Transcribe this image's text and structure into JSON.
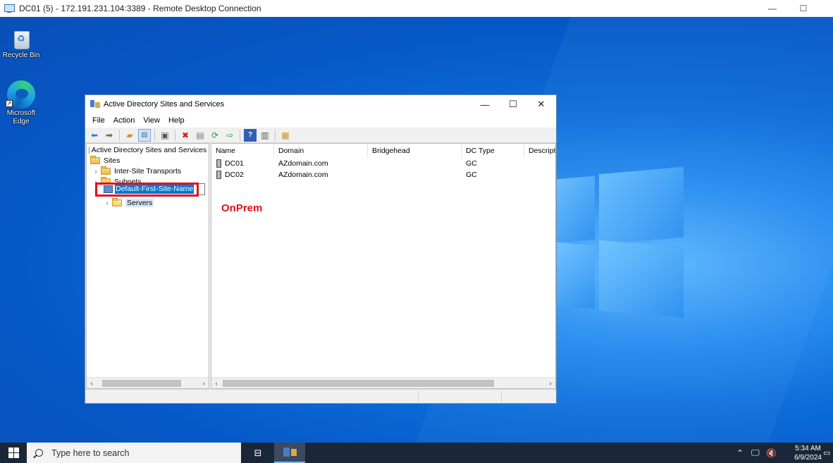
{
  "rdp": {
    "title": "DC01 (5) - 172.191.231.104:3389 - Remote Desktop Connection",
    "minimize": "—",
    "maximize": "☐"
  },
  "desktop": {
    "icons": [
      {
        "label": "Recycle Bin",
        "icon": "recycle-bin-icon"
      },
      {
        "label": "Microsoft Edge",
        "icon": "edge-icon"
      }
    ]
  },
  "window": {
    "title": "Active Directory Sites and Services",
    "minimize": "—",
    "maximize": "☐",
    "close": "✕",
    "menu": [
      "File",
      "Action",
      "View",
      "Help"
    ]
  },
  "tree": {
    "root": "Active Directory Sites and Services [",
    "sites": "Sites",
    "inter_site": "Inter-Site Transports",
    "subnets": "Subnets",
    "rename_value": "Default-First-Site-Name",
    "servers": "Servers"
  },
  "list": {
    "columns": [
      "Name",
      "Domain",
      "Bridgehead",
      "DC Type",
      "Descript"
    ],
    "rows": [
      {
        "name": "DC01",
        "domain": "AZdomain.com",
        "bridgehead": "",
        "dctype": "GC"
      },
      {
        "name": "DC02",
        "domain": "AZdomain.com",
        "bridgehead": "",
        "dctype": "GC"
      }
    ],
    "annotation": "OnPrem",
    "annotation_color": "#e0121c"
  },
  "taskbar": {
    "search_placeholder": "Type here to search",
    "time": "5:34 AM",
    "date": "6/9/2024"
  }
}
